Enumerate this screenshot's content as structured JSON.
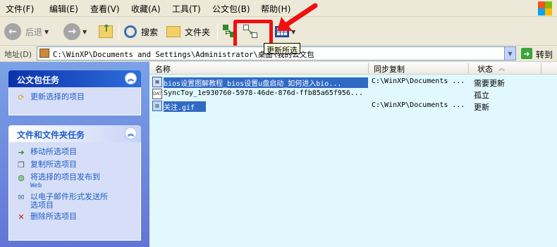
{
  "menu": {
    "items": [
      "文件(F)",
      "编辑(E)",
      "查看(V)",
      "收藏(A)",
      "工具(T)",
      "公文包(B)",
      "帮助(H)"
    ]
  },
  "toolbar": {
    "back": "后退",
    "search": "搜索",
    "folders": "文件夹",
    "update_tooltip": "更新所选"
  },
  "address": {
    "label": "地址(D)",
    "path": "C:\\WinXP\\Documents and Settings\\Administrator\\桌面\\我的公文包",
    "go": "转到"
  },
  "left_pane": {
    "briefcase_tasks": {
      "title": "公文包任务",
      "items": [
        "更新选择的项目"
      ]
    },
    "file_tasks": {
      "title": "文件和文件夹任务",
      "items": [
        {
          "label": "移动所选项目"
        },
        {
          "label": "复制所选项目"
        },
        {
          "label": "将选择的项目发布到",
          "sub": "Web"
        },
        {
          "label": "以电子邮件形式发送所",
          "label2": "选项目"
        },
        {
          "label": "删除所选项目"
        }
      ]
    }
  },
  "file_list": {
    "columns": [
      "名称",
      "同步复制",
      "状态"
    ],
    "rows": [
      {
        "name": "bios设置图解教程_bios设置u盘启动_如何进入bio...",
        "sync": "C:\\WinXP\\Documents ...",
        "status": "需要更新",
        "selected": true,
        "icon": "doc"
      },
      {
        "name": "SyncToy_1e930760-5978-46de-876d-ffb85a65f956...",
        "sync": "",
        "status": "孤立",
        "selected": false,
        "icon": "dat"
      },
      {
        "name": "关注.gif",
        "sync": "C:\\WinXP\\Documents ...",
        "status": "更新",
        "selected": true,
        "icon": "gif"
      }
    ]
  },
  "colors": {
    "annotation_red": "#f00f0f",
    "selection_blue": "#316ac5",
    "list_background": "#e0f8fe"
  }
}
